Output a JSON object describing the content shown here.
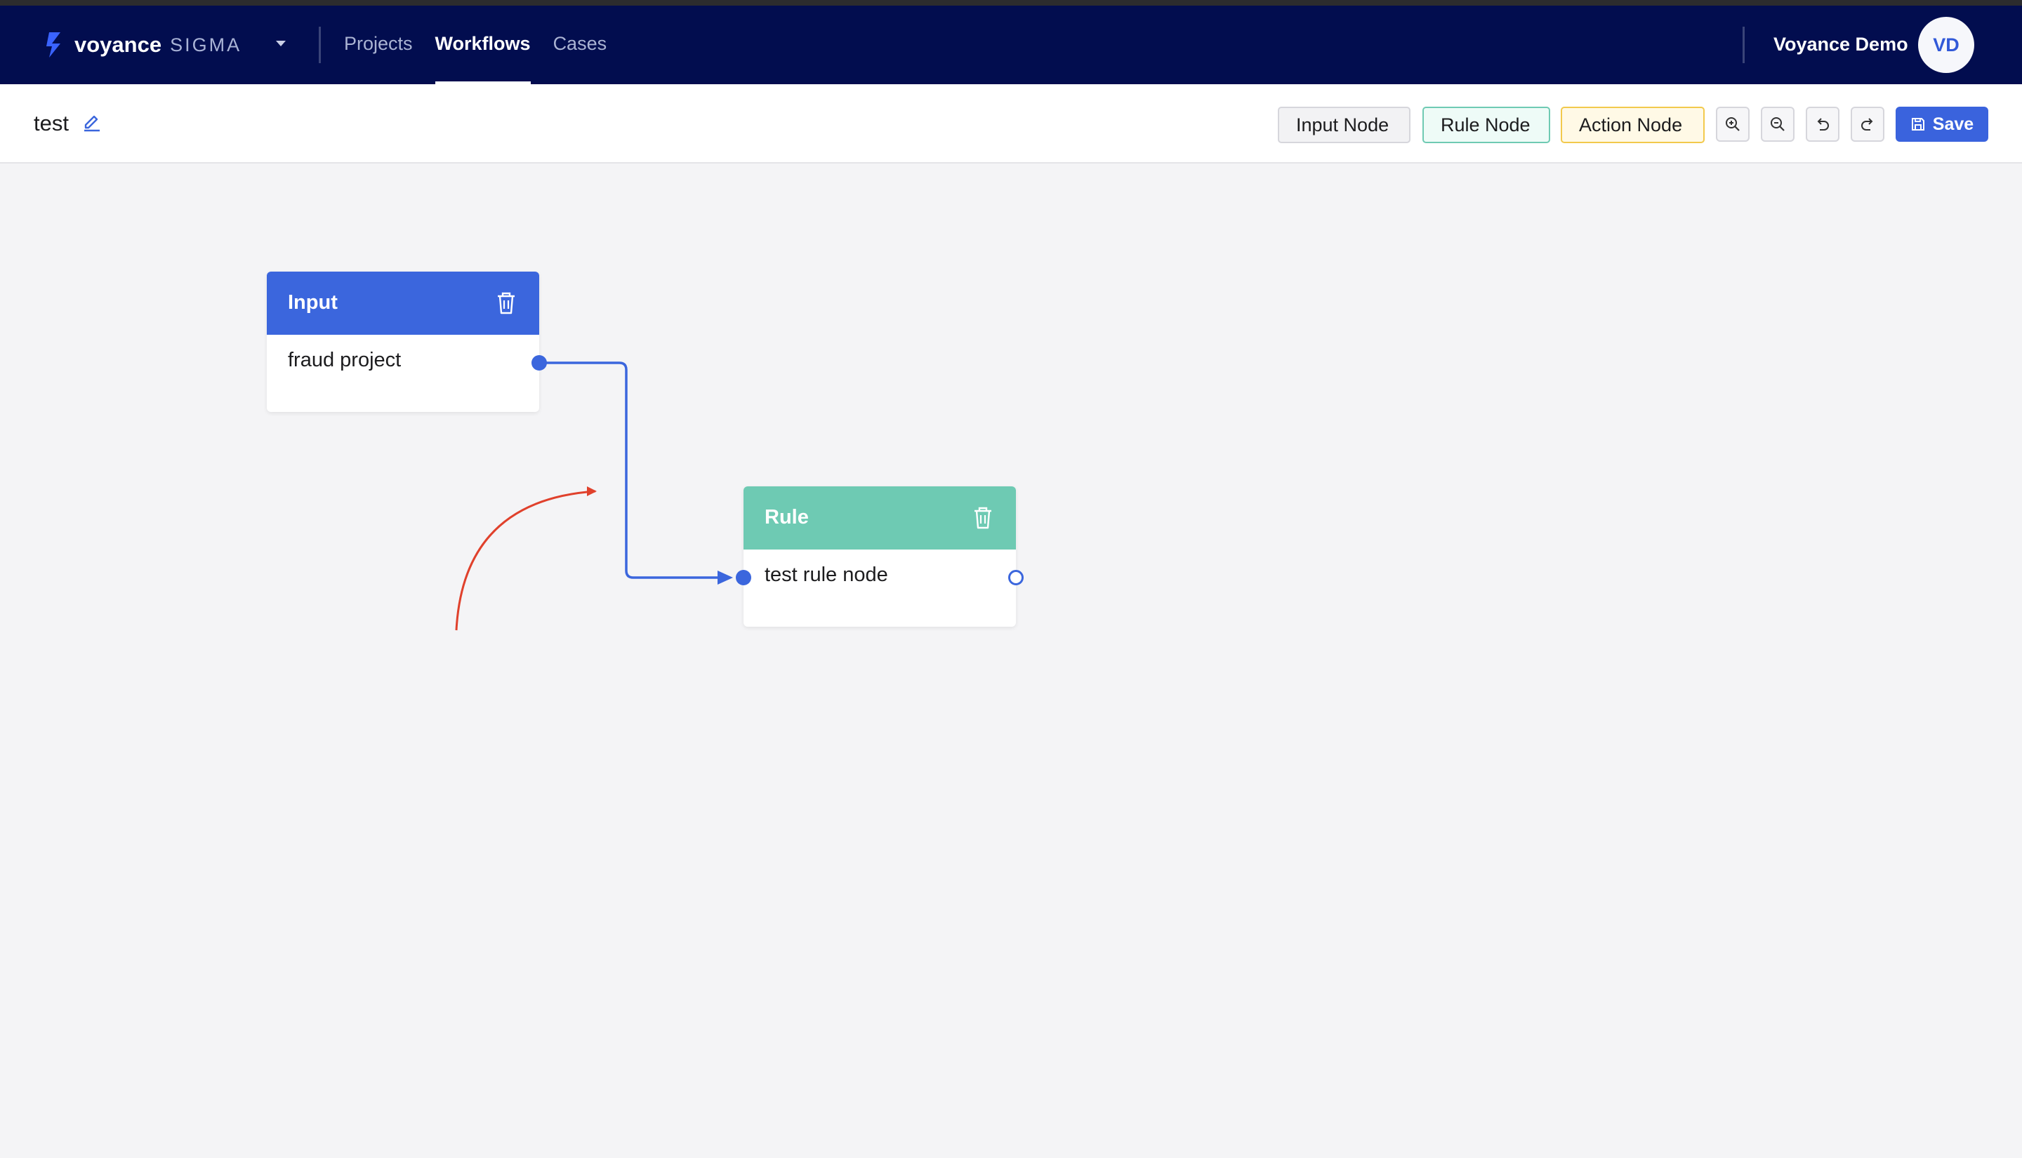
{
  "app": {
    "brand": "voyance",
    "brand_sub": "SIGMA",
    "nav": [
      {
        "label": "Projects",
        "active": false
      },
      {
        "label": "Workflows",
        "active": true
      },
      {
        "label": "Cases",
        "active": false
      }
    ],
    "user_name": "Voyance Demo",
    "avatar_initials": "VD"
  },
  "toolbar": {
    "workflow_title": "test",
    "input_node_label": "Input Node",
    "rule_node_label": "Rule Node",
    "action_node_label": "Action Node",
    "save_label": "Save",
    "icons": [
      "zoom-in-icon",
      "zoom-out-icon",
      "undo-icon",
      "redo-icon",
      "save-icon",
      "pencil-icon"
    ]
  },
  "canvas": {
    "nodes": [
      {
        "type": "Input",
        "body": "fraud project"
      },
      {
        "type": "Rule",
        "body": "test rule node"
      }
    ],
    "edges": [
      {
        "from": "Input",
        "to": "Rule"
      }
    ]
  },
  "colors": {
    "nav_bg": "#020d4f",
    "accent_blue": "#3b66dd",
    "rule_green": "#6ecab3",
    "action_yellow": "#f2c94c",
    "annotation_red": "#e0412c"
  }
}
